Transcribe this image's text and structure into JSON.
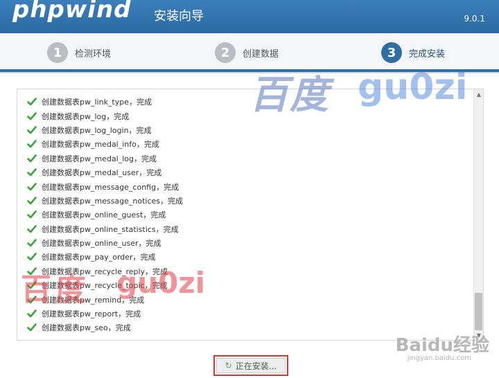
{
  "header": {
    "logo": "phpwind",
    "title": "安装向导",
    "version": "9.0.1"
  },
  "steps": [
    {
      "num": "1",
      "label": "检测环境"
    },
    {
      "num": "2",
      "label": "创建数据"
    },
    {
      "num": "3",
      "label": "完成安装"
    }
  ],
  "log": [
    "创建数据表pw_link_type，完成",
    "创建数据表pw_log，完成",
    "创建数据表pw_log_login，完成",
    "创建数据表pw_medal_info，完成",
    "创建数据表pw_medal_log，完成",
    "创建数据表pw_medal_user，完成",
    "创建数据表pw_message_config，完成",
    "创建数据表pw_message_notices，完成",
    "创建数据表pw_online_guest，完成",
    "创建数据表pw_online_statistics，完成",
    "创建数据表pw_online_user，完成",
    "创建数据表pw_pay_order，完成",
    "创建数据表pw_recycle_reply，完成",
    "创建数据表pw_recycle_topic，完成",
    "创建数据表pw_remind，完成",
    "创建数据表pw_report，完成",
    "创建数据表pw_seo，完成"
  ],
  "button": {
    "label": "正在安装..."
  },
  "watermarks": {
    "wm1_text": "百度",
    "wm1_user": "gu0zi",
    "wm2_text": "百度",
    "wm2_user": "gu0zi",
    "wm3_text": "Baidu经验",
    "wm3_sub": "jingyan.baidu.com"
  },
  "colors": {
    "header": "#2a6aa3",
    "active_step": "#2e6ea5",
    "inactive_step": "#b8bec4",
    "check": "#3aa335",
    "button_highlight": "#d9342b"
  }
}
